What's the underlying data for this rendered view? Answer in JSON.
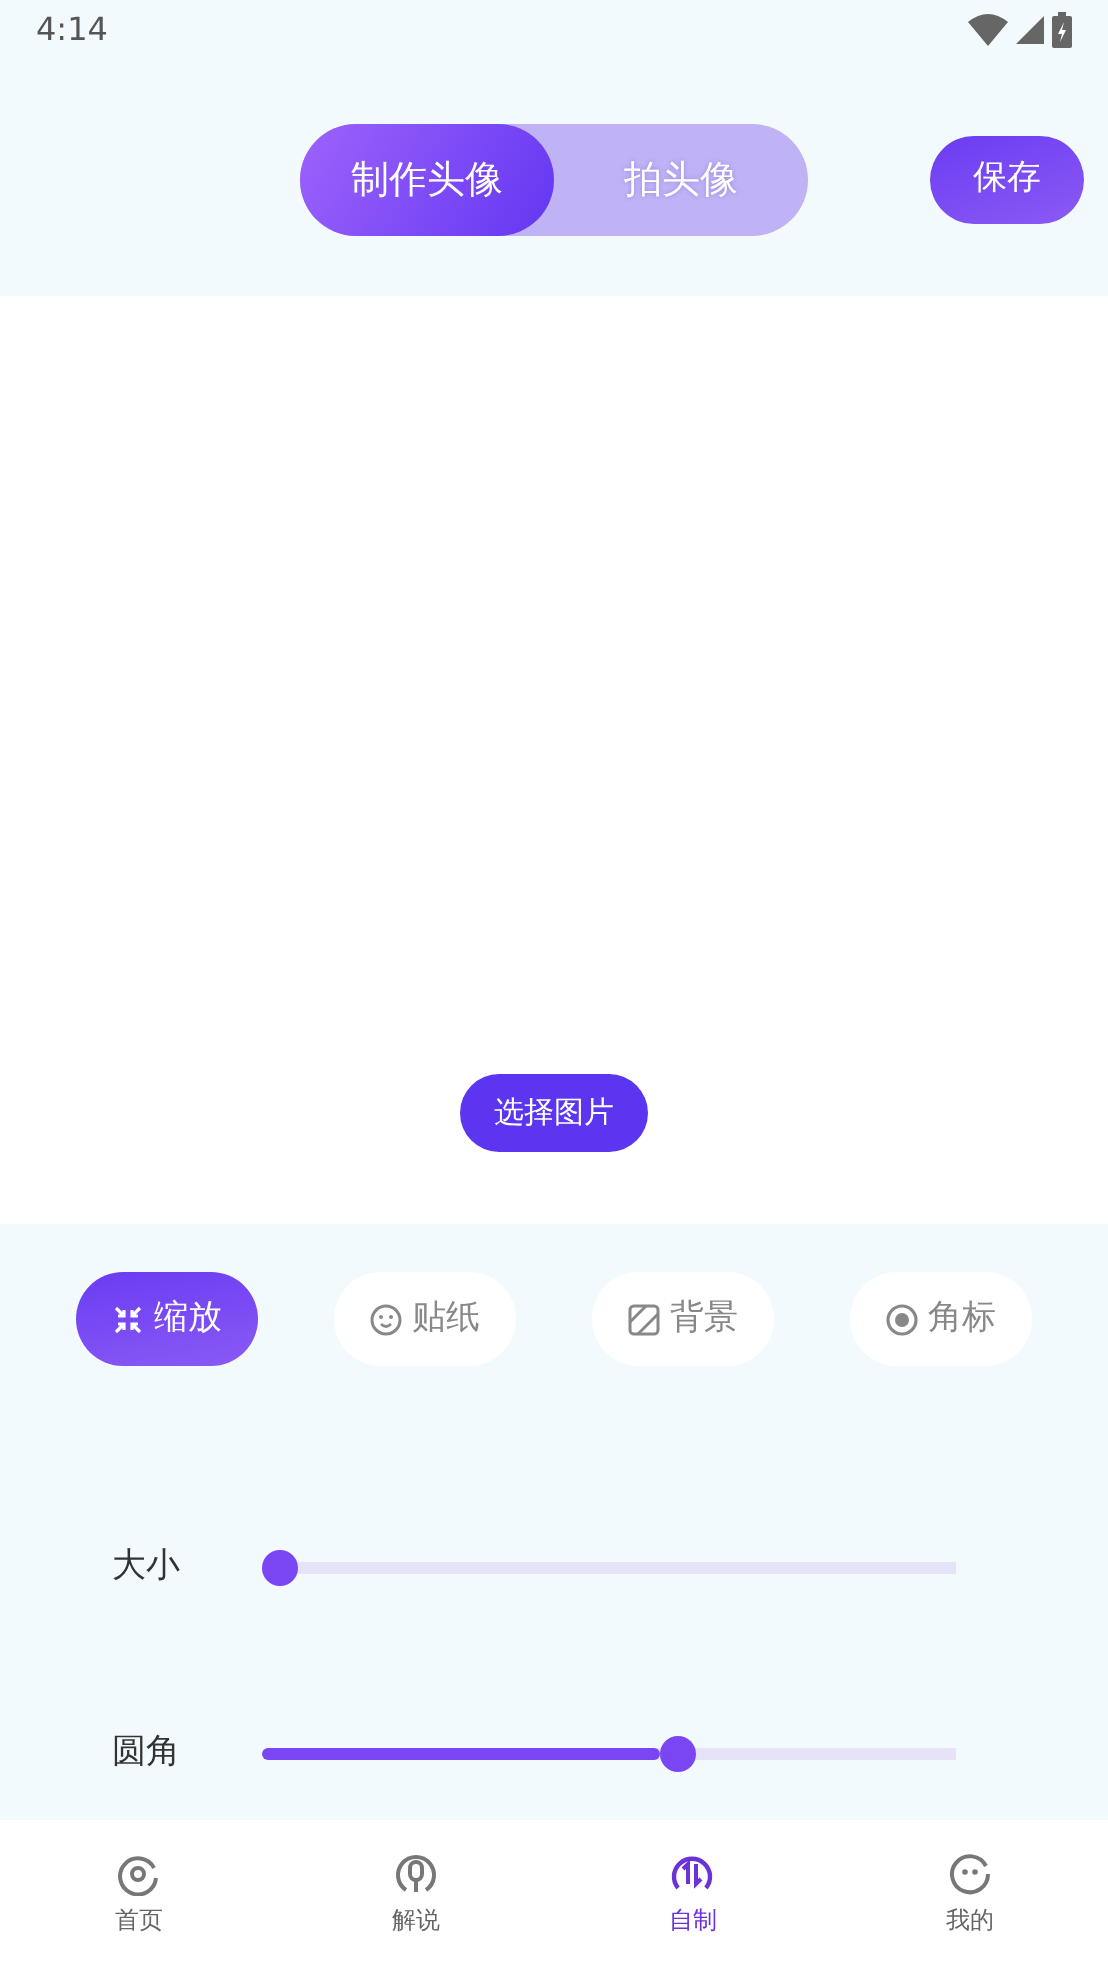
{
  "status_bar": {
    "time": "4:14"
  },
  "mode_tabs": [
    {
      "label": "制作头像",
      "selected": true
    },
    {
      "label": "拍头像",
      "selected": false
    }
  ],
  "save_button": "保存",
  "canvas": {
    "choose_button": "选择图片"
  },
  "tools": [
    {
      "label": "缩放",
      "selected": true
    },
    {
      "label": "贴纸",
      "selected": false
    },
    {
      "label": "背景",
      "selected": false
    },
    {
      "label": "角标",
      "selected": false
    }
  ],
  "sliders": [
    {
      "label": "大小",
      "level": 0
    },
    {
      "label": "圆角",
      "level": 0.56
    }
  ],
  "bottom_nav": [
    {
      "label": "首页",
      "selected": false
    },
    {
      "label": "解说",
      "selected": false
    },
    {
      "label": "自制",
      "selected": true
    },
    {
      "label": "我的",
      "selected": false
    }
  ]
}
